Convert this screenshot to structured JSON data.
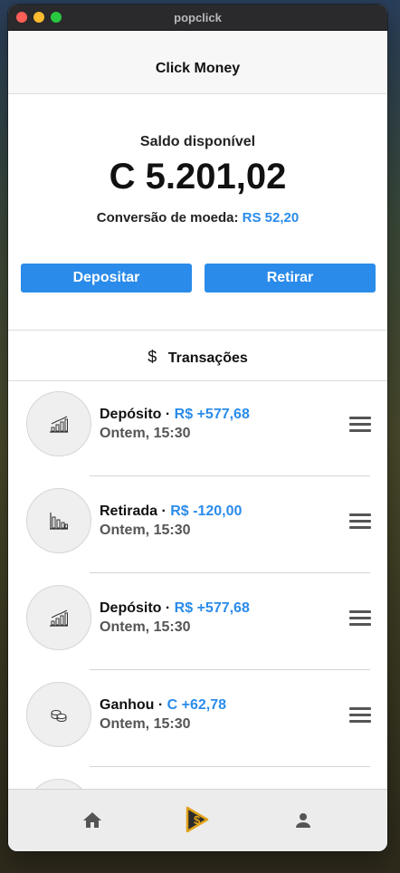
{
  "window": {
    "title": "popclick"
  },
  "navbar": {
    "title": "Click Money"
  },
  "balance": {
    "label": "Saldo disponível",
    "value": "C 5.201,02",
    "conversion_label": "Conversão de moeda:",
    "conversion_value": "RS 52,20"
  },
  "actions": {
    "deposit_label": "Depositar",
    "withdraw_label": "Retirar"
  },
  "transactions": {
    "header_icon": "$",
    "header_label": "Transações",
    "items": [
      {
        "icon": "chart-up-icon",
        "type": "Depósito",
        "amount": "R$ +577,68",
        "time": "Ontem, 15:30"
      },
      {
        "icon": "chart-down-icon",
        "type": "Retirada",
        "amount": "R$ -120,00",
        "time": "Ontem, 15:30"
      },
      {
        "icon": "chart-up-icon",
        "type": "Depósito",
        "amount": "R$ +577,68",
        "time": "Ontem, 15:30"
      },
      {
        "icon": "coins-icon",
        "type": "Ganhou",
        "amount": "C +62,78",
        "time": "Ontem, 15:30"
      }
    ]
  },
  "tabbar": {
    "items": [
      "home-icon",
      "popclick-logo-icon",
      "profile-icon"
    ]
  },
  "colors": {
    "accent": "#2a8bea",
    "navbar_bg": "#f7f7f7",
    "tabbar_bg": "#ececec"
  }
}
